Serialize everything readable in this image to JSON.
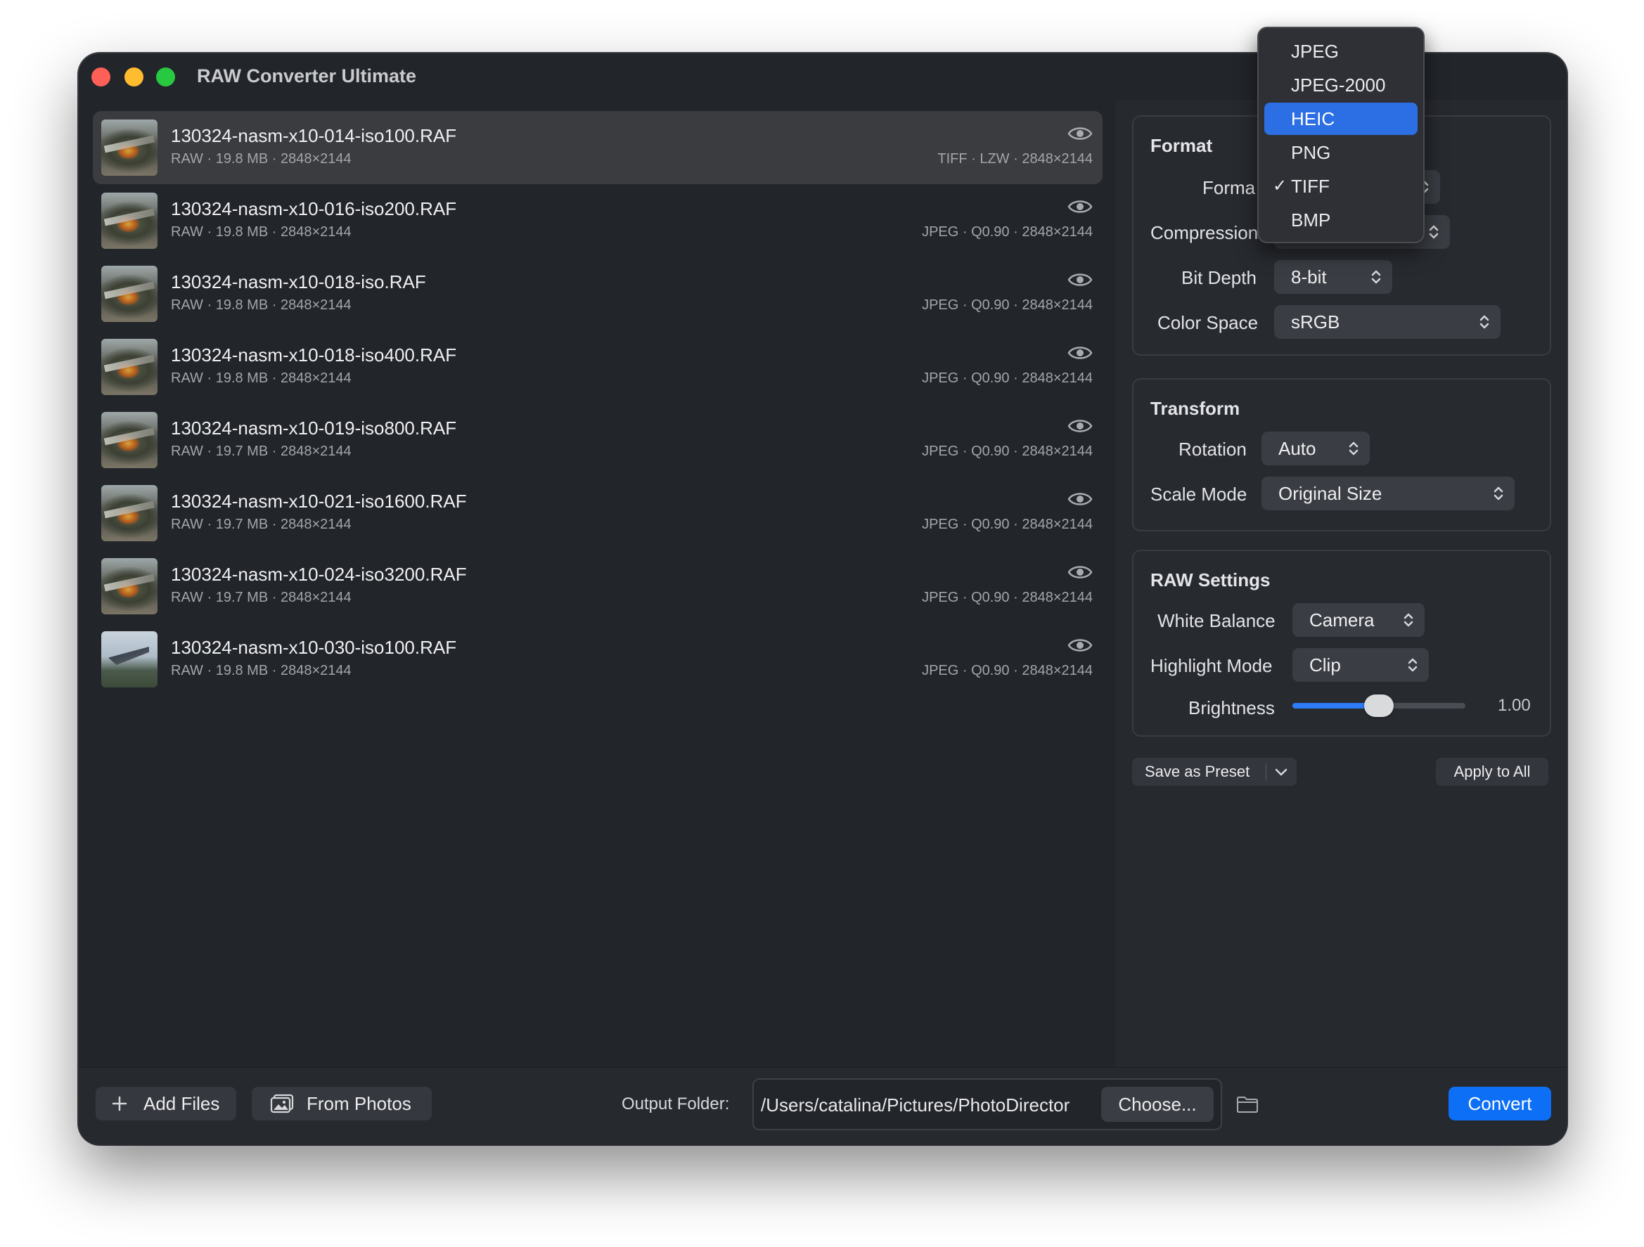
{
  "window": {
    "title": "RAW Converter Ultimate"
  },
  "files": [
    {
      "name": "130324-nasm-x10-014-iso100.RAF",
      "meta": "RAW · 19.8 MB · 2848×2144",
      "output": "TIFF · LZW · 2848×2144",
      "thumb": "rocket"
    },
    {
      "name": "130324-nasm-x10-016-iso200.RAF",
      "meta": "RAW · 19.8 MB · 2848×2144",
      "output": "JPEG · Q0.90 · 2848×2144",
      "thumb": "rocket"
    },
    {
      "name": "130324-nasm-x10-018-iso.RAF",
      "meta": "RAW · 19.8 MB · 2848×2144",
      "output": "JPEG · Q0.90 · 2848×2144",
      "thumb": "rocket"
    },
    {
      "name": "130324-nasm-x10-018-iso400.RAF",
      "meta": "RAW · 19.8 MB · 2848×2144",
      "output": "JPEG · Q0.90 · 2848×2144",
      "thumb": "rocket"
    },
    {
      "name": "130324-nasm-x10-019-iso800.RAF",
      "meta": "RAW · 19.7 MB · 2848×2144",
      "output": "JPEG · Q0.90 · 2848×2144",
      "thumb": "rocket"
    },
    {
      "name": "130324-nasm-x10-021-iso1600.RAF",
      "meta": "RAW · 19.7 MB · 2848×2144",
      "output": "JPEG · Q0.90 · 2848×2144",
      "thumb": "rocket"
    },
    {
      "name": "130324-nasm-x10-024-iso3200.RAF",
      "meta": "RAW · 19.7 MB · 2848×2144",
      "output": "JPEG · Q0.90 · 2848×2144",
      "thumb": "rocket"
    },
    {
      "name": "130324-nasm-x10-030-iso100.RAF",
      "meta": "RAW · 19.8 MB · 2848×2144",
      "output": "JPEG · Q0.90 · 2848×2144",
      "thumb": "plane"
    }
  ],
  "format_group": {
    "title": "Format",
    "format_label": "Forma",
    "compression_label": "Compression",
    "bit_depth_label": "Bit Depth",
    "bit_depth_value": "8-bit",
    "color_space_label": "Color Space",
    "color_space_value": "sRGB"
  },
  "transform_group": {
    "title": "Transform",
    "rotation_label": "Rotation",
    "rotation_value": "Auto",
    "scale_mode_label": "Scale Mode",
    "scale_mode_value": "Original Size"
  },
  "raw_group": {
    "title": "RAW Settings",
    "white_balance_label": "White Balance",
    "white_balance_value": "Camera",
    "highlight_mode_label": "Highlight Mode",
    "highlight_mode_value": "Clip",
    "brightness_label": "Brightness",
    "brightness_value": "1.00",
    "brightness_fraction": 0.5
  },
  "actions": {
    "save_preset": "Save as Preset",
    "apply_all": "Apply to All"
  },
  "bottom": {
    "add_files": "Add Files",
    "from_photos": "From Photos",
    "output_label": "Output Folder:",
    "output_path": "/Users/catalina/Pictures/PhotoDirector",
    "choose": "Choose...",
    "convert": "Convert"
  },
  "format_menu": {
    "items": [
      "JPEG",
      "JPEG-2000",
      "HEIC",
      "PNG",
      "TIFF",
      "BMP"
    ],
    "highlighted": "HEIC",
    "checked": "TIFF"
  },
  "colors": {
    "accent": "#0c6ff5",
    "highlight": "#2c6ee3",
    "background": "#22252a"
  }
}
